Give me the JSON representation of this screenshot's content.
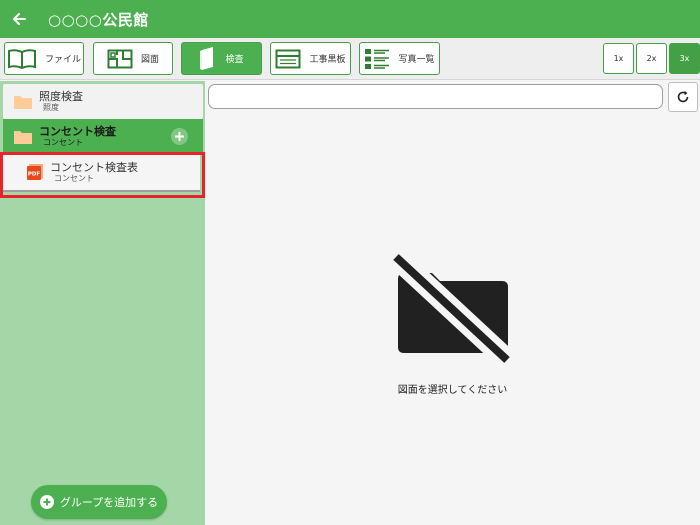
{
  "header": {
    "title": "○○○○公民館",
    "back_icon": "arrow-left-icon"
  },
  "toolbar": {
    "buttons": [
      {
        "label": "ファイル",
        "icon": "book-icon",
        "active": false
      },
      {
        "label": "図面",
        "icon": "floorplan-icon",
        "active": false
      },
      {
        "label": "検査",
        "icon": "notebook-icon",
        "active": true
      },
      {
        "label": "工事黒板",
        "icon": "blackboard-icon",
        "active": false
      },
      {
        "label": "写真一覧",
        "icon": "list-icon",
        "active": false
      }
    ],
    "zoom": [
      {
        "label": "1x",
        "active": false
      },
      {
        "label": "2x",
        "active": false
      },
      {
        "label": "3x",
        "active": true
      }
    ]
  },
  "sidebar": {
    "groups": [
      {
        "name": "照度検査",
        "sub": "照度"
      },
      {
        "name": "コンセント検査",
        "sub": "コンセント"
      }
    ],
    "documents": [
      {
        "name": "コンセント検査表",
        "sub": "コンセント",
        "icon": "pdf-icon"
      }
    ],
    "add_group_label": "グループを追加する"
  },
  "main": {
    "search_value": "",
    "empty_message": "図面を選択してください"
  },
  "colors": {
    "primary": "#4caf50",
    "sidebar_bg": "#a5d6a7",
    "highlight": "#e8232a"
  }
}
